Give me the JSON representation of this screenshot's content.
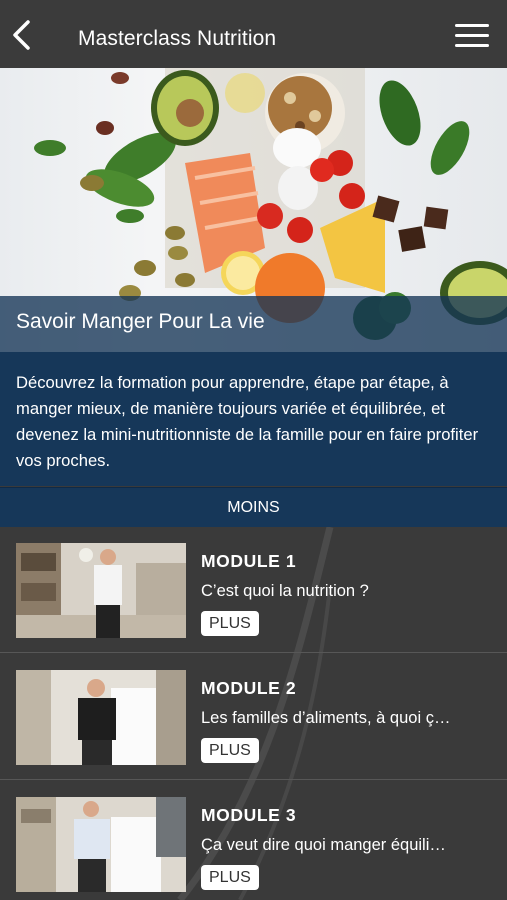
{
  "header": {
    "title": "Masterclass Nutrition",
    "back_icon": "chevron-left-icon",
    "menu_icon": "hamburger-menu-icon"
  },
  "hero": {
    "title": "Savoir Manger Pour La vie"
  },
  "description": {
    "text": "Découvrez la formation pour apprendre, étape par étape, à manger mieux, de manière toujours variée et équilibrée, et devenez la mini-nutritionniste de la famille pour en faire profiter vos proches.",
    "toggle_label": "MOINS"
  },
  "modules": [
    {
      "title": "MODULE 1",
      "subtitle": "C’est quoi la nutrition ?",
      "button": "PLUS"
    },
    {
      "title": "MODULE 2",
      "subtitle": "Les familles d’aliments, à quoi ç…",
      "button": "PLUS"
    },
    {
      "title": "MODULE 3",
      "subtitle": "Ça veut dire quoi manger équili…",
      "button": "PLUS"
    }
  ],
  "colors": {
    "topbar": "#3b3b3b",
    "navy": "#163759",
    "list_bg": "#3a3a3a"
  }
}
